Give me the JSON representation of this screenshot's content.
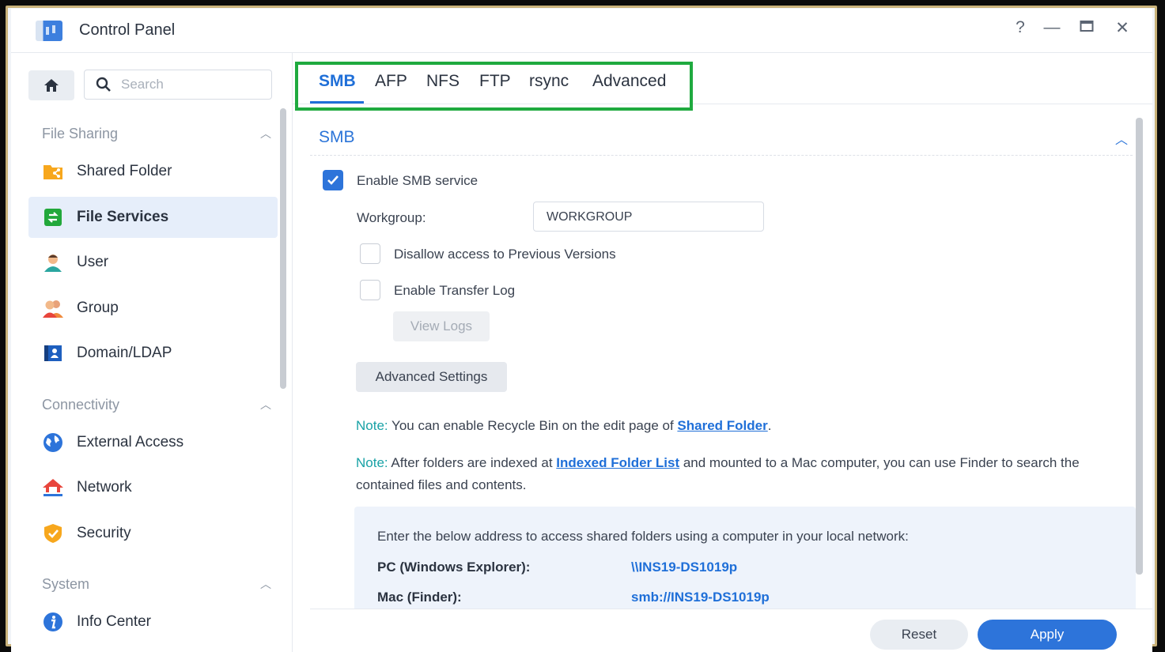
{
  "window": {
    "title": "Control Panel",
    "controls": {
      "help": "?",
      "minimize": "—",
      "maximize": "□",
      "close": "✕"
    }
  },
  "sidebar": {
    "search_placeholder": "Search",
    "sections": [
      {
        "title": "File Sharing",
        "items": [
          {
            "label": "Shared Folder",
            "icon": "shared-folder-icon"
          },
          {
            "label": "File Services",
            "icon": "file-services-icon",
            "active": true
          },
          {
            "label": "User",
            "icon": "user-icon"
          },
          {
            "label": "Group",
            "icon": "group-icon"
          },
          {
            "label": "Domain/LDAP",
            "icon": "domain-ldap-icon"
          }
        ]
      },
      {
        "title": "Connectivity",
        "items": [
          {
            "label": "External Access",
            "icon": "globe-icon"
          },
          {
            "label": "Network",
            "icon": "network-icon"
          },
          {
            "label": "Security",
            "icon": "shield-icon"
          }
        ]
      },
      {
        "title": "System",
        "items": [
          {
            "label": "Info Center",
            "icon": "info-icon"
          }
        ]
      }
    ]
  },
  "tabs": [
    "SMB",
    "AFP",
    "NFS",
    "FTP",
    "rsync",
    "Advanced"
  ],
  "smb": {
    "section_title": "SMB",
    "enable_label": "Enable SMB service",
    "workgroup_label": "Workgroup:",
    "workgroup_value": "WORKGROUP",
    "disallow_label": "Disallow access to Previous Versions",
    "transfer_log_label": "Enable Transfer Log",
    "view_logs": "View Logs",
    "advanced_settings": "Advanced Settings",
    "note_tag": "Note:",
    "note1_text": " You can enable Recycle Bin on the edit page of ",
    "note1_link": "Shared Folder",
    "note1_end": ".",
    "note2_text": " After folders are indexed at ",
    "note2_link": "Indexed Folder List",
    "note2_end": " and mounted to a Mac computer, you can use Finder to search the contained files and contents.",
    "address_intro": "Enter the below address to access shared folders using a computer in your local network:",
    "pc_label": "PC (Windows Explorer):",
    "pc_value": "\\\\INS19-DS1019p",
    "mac_label": "Mac (Finder):",
    "mac_value": "smb://INS19-DS1019p"
  },
  "footer": {
    "reset": "Reset",
    "apply": "Apply"
  },
  "colors": {
    "accent": "#2d74da",
    "highlight": "#1faa3f",
    "note": "#19a2a6"
  }
}
